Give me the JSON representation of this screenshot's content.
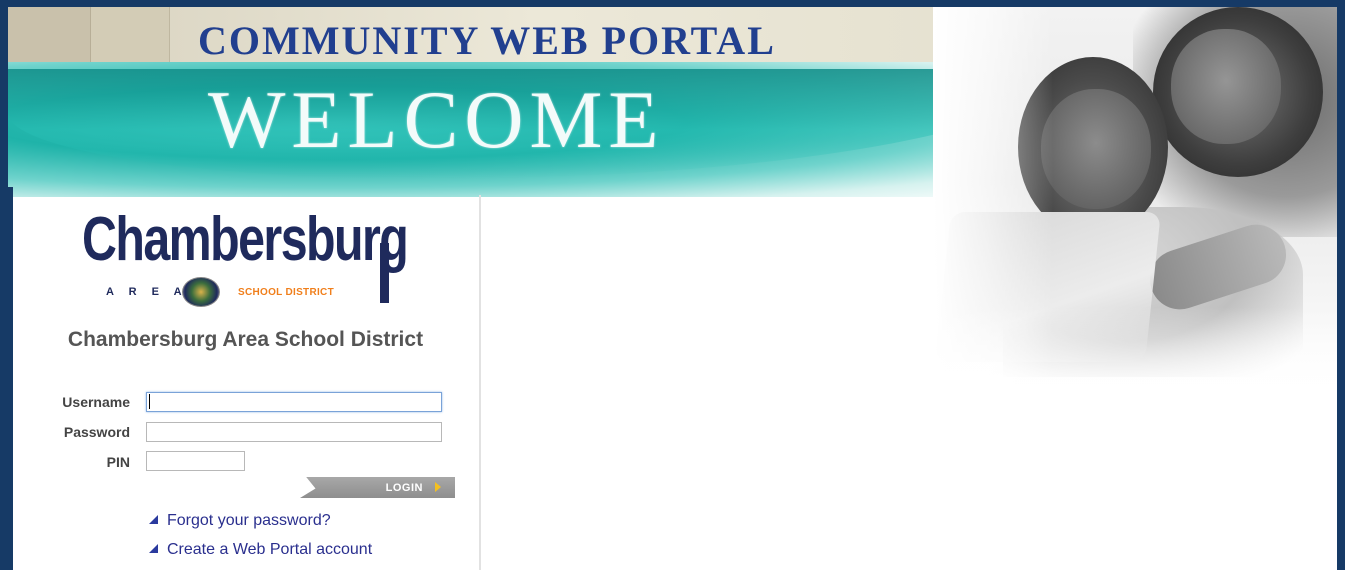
{
  "banner": {
    "portal_title": "COMMUNITY WEB PORTAL",
    "welcome": "WELCOME"
  },
  "logo": {
    "wordmark": "Chambersburg",
    "area": "AREA",
    "district": "SCHOOL DISTRICT"
  },
  "district_name": "Chambersburg Area School District",
  "form": {
    "username_label": "Username",
    "username_value": "",
    "password_label": "Password",
    "password_value": "",
    "pin_label": "PIN",
    "pin_value": "",
    "login_label": "LOGIN"
  },
  "links": {
    "forgot_password": "Forgot your password?",
    "create_account": "Create a Web Portal account"
  },
  "colors": {
    "frame": "#163a66",
    "title": "#213f8f",
    "teal": "#1fb3a9",
    "link": "#2a2f8e",
    "login_arrow": "#f4c020"
  }
}
